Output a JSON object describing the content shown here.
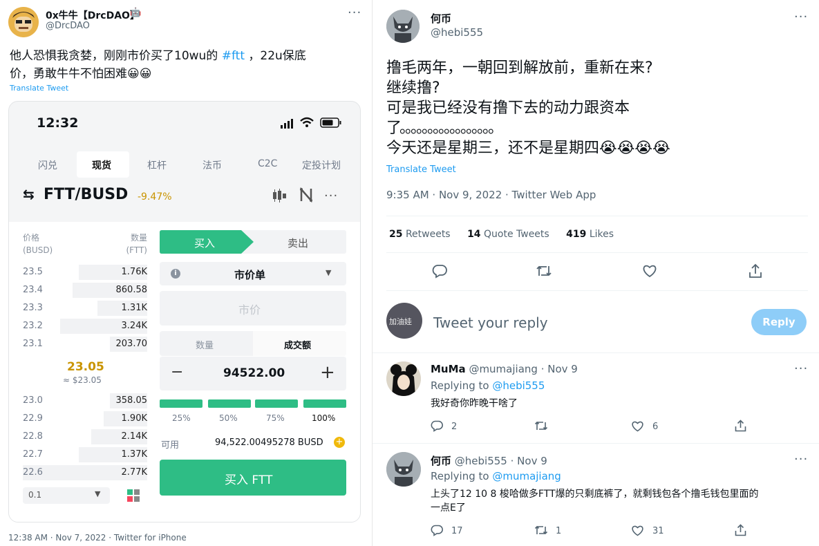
{
  "left_tweet": {
    "author_name": "0x牛牛【DrcDAO】",
    "author_handle": "@DrcDAO",
    "text_line1_a": "他人恐惧我贪婪，刚刚市价买了10wu的 ",
    "hashtag": "#ftt",
    "text_line1_b": " ，22u保底",
    "text_line2": "价，勇敢牛牛不怕困难😀😀",
    "translate": "Translate Tweet",
    "footer": "12:38 AM · Nov 7, 2022 · Twitter for iPhone",
    "more": "···"
  },
  "phone": {
    "time": "12:32",
    "tabs": [
      "闪兑",
      "现货",
      "杠杆",
      "法币",
      "C2C",
      "定投计划"
    ],
    "pair_arrows": "⇆",
    "pair": "FTT/BUSD",
    "change": "-9.47%",
    "pair_more": "···",
    "col_price_1": "价格",
    "col_price_2": "(BUSD)",
    "col_qty_1": "数量",
    "col_qty_2": "(FTT)",
    "asks": [
      {
        "price": "23.5",
        "qty": "1.76K",
        "depth": 0.55
      },
      {
        "price": "23.4",
        "qty": "860.58",
        "depth": 0.6
      },
      {
        "price": "23.3",
        "qty": "1.31K",
        "depth": 0.4
      },
      {
        "price": "23.2",
        "qty": "3.24K",
        "depth": 0.7
      },
      {
        "price": "23.1",
        "qty": "203.70",
        "depth": 0.3
      }
    ],
    "mid_price": "23.05",
    "mid_usd": "≈ $23.05",
    "bids": [
      {
        "price": "23.0",
        "qty": "358.05",
        "depth": 0.3
      },
      {
        "price": "22.9",
        "qty": "1.90K",
        "depth": 0.35
      },
      {
        "price": "22.8",
        "qty": "2.14K",
        "depth": 0.45
      },
      {
        "price": "22.7",
        "qty": "1.37K",
        "depth": 0.55
      },
      {
        "price": "22.6",
        "qty": "2.77K",
        "depth": 1.0
      }
    ],
    "depth_select": "0.1",
    "buy_tab": "买入",
    "sell_tab": "卖出",
    "order_info_icon": "i",
    "order_type": "市价单",
    "price_placeholder": "市价",
    "qty_tab": "数量",
    "amount_tab": "成交额",
    "minus": "−",
    "plus": "+",
    "amount_value": "94522.00",
    "percents": [
      "25%",
      "50%",
      "75%",
      "100%"
    ],
    "available_label": "可用",
    "available_value": "94,522.00495278 BUSD",
    "buy_button": "买入 FTT",
    "colors": {
      "green": "#2ebd85",
      "red": "#f6465d",
      "gold": "#c99400"
    }
  },
  "right_tweet": {
    "author_name": "何币",
    "author_handle": "@hebi555",
    "more": "···",
    "lines": [
      "撸毛两年，一朝回到解放前，重新在来?",
      "继续撸?",
      "可是我已经没有撸下去的动力跟资本",
      "了。。。。。。。。。。。。。。。。。",
      "今天还是星期三，还不是星期四😭😭😭😭"
    ],
    "translate": "Translate Tweet",
    "meta": "9:35 AM · Nov 9, 2022 · Twitter Web App",
    "retweets_count": "25",
    "retweets_label": "Retweets",
    "quotes_count": "14",
    "quotes_label": "Quote Tweets",
    "likes_count": "419",
    "likes_label": "Likes",
    "reply_avatar_text": "加油娃",
    "reply_placeholder": "Tweet your reply",
    "reply_button": "Reply"
  },
  "replies": [
    {
      "name": "MuMa",
      "handle": "@mumajiang",
      "date": "· Nov 9",
      "replying_label": "Replying to ",
      "replying_to": "@hebi555",
      "text_1": "我好奇你昨晚干啥了",
      "text_2": "",
      "reply_count": "2",
      "retweet_count": "",
      "like_count": "6"
    },
    {
      "name": "何币",
      "handle": "@hebi555",
      "date": "· Nov 9",
      "replying_label": "Replying to ",
      "replying_to": "@mumajiang",
      "text_1": "上头了12  10  8 梭哈做多FTT爆的只剩底裤了，就剩钱包各个撸毛钱包里面的",
      "text_2": "一点E了",
      "reply_count": "17",
      "retweet_count": "1",
      "like_count": "31"
    }
  ],
  "icons": {
    "reply": "reply-icon",
    "retweet": "retweet-icon",
    "like": "heart-icon",
    "share": "share-icon"
  }
}
